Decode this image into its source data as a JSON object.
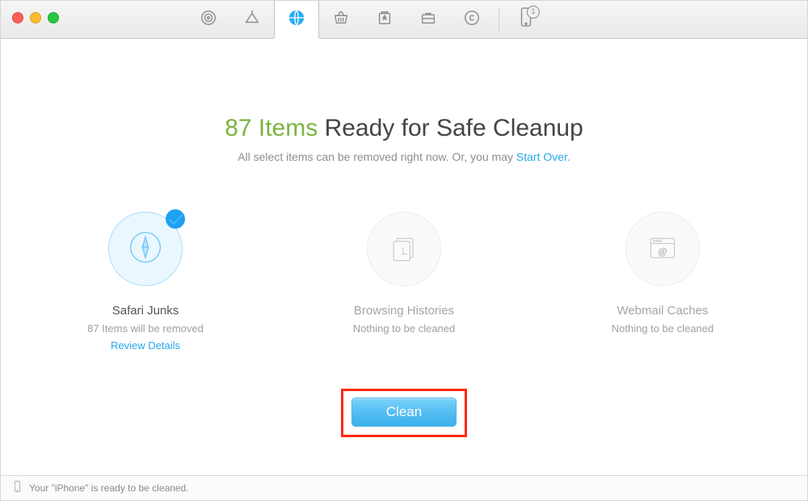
{
  "header": {
    "tabs": [
      "target",
      "broom",
      "globe",
      "basket",
      "recycle",
      "briefcase",
      "copyright"
    ],
    "active_tab_index": 2,
    "phone_badge": "1"
  },
  "headline": {
    "count_text": "87 Items",
    "rest_text": " Ready for Safe Cleanup"
  },
  "subtitle": {
    "before": "All select items can be removed right now. Or, you may ",
    "link": "Start Over",
    "after": "."
  },
  "cards": [
    {
      "id": "safari-junks",
      "title": "Safari Junks",
      "sub": "87 Items will be removed",
      "review": "Review Details",
      "selected": true
    },
    {
      "id": "browsing-histories",
      "title": "Browsing Histories",
      "sub": "Nothing to be cleaned",
      "selected": false
    },
    {
      "id": "webmail-caches",
      "title": "Webmail Caches",
      "sub": "Nothing to be cleaned",
      "selected": false
    }
  ],
  "action": {
    "clean_label": "Clean"
  },
  "status": {
    "text": "Your \"iPhone\" is ready to be cleaned."
  }
}
